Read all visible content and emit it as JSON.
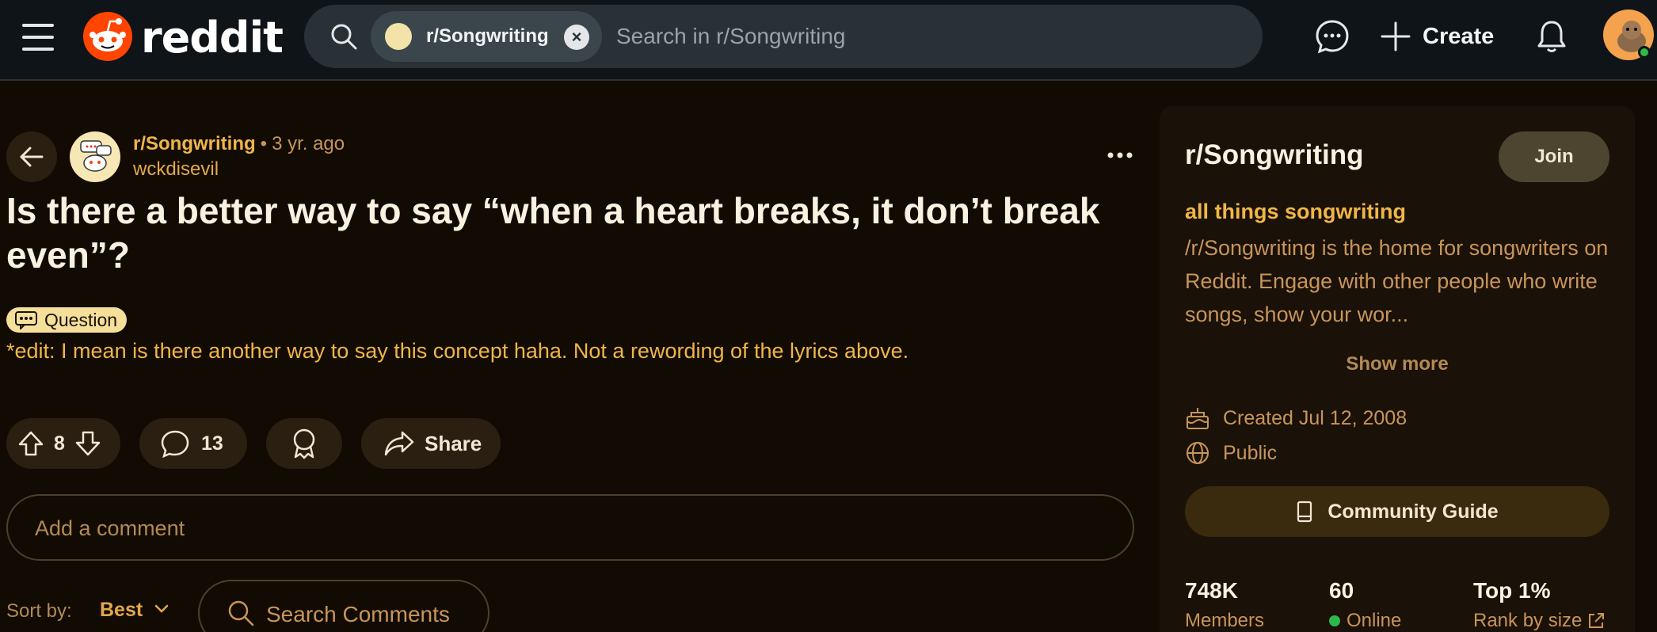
{
  "header": {
    "logo_text": "reddit",
    "search": {
      "scope_label": "r/Songwriting",
      "placeholder": "Search in r/Songwriting"
    },
    "create_label": "Create",
    "icons": [
      "menu-icon",
      "search-icon",
      "chat-icon",
      "plus-icon",
      "bell-icon"
    ]
  },
  "post": {
    "subreddit": "r/Songwriting",
    "separator": "•",
    "time": "3 yr. ago",
    "author": "wckdisevil",
    "title": "Is there a better way to say “when a heart breaks, it don’t break even”?",
    "flair": "Question",
    "body": "*edit: I mean is there another way to say this concept haha. Not a rewording of the lyrics above.",
    "votes": "8",
    "comments": "13",
    "share_label": "Share"
  },
  "comment_box": {
    "placeholder": "Add a comment"
  },
  "sort": {
    "label": "Sort by:",
    "value": "Best",
    "search_placeholder": "Search Comments"
  },
  "sidebar": {
    "title": "r/Songwriting",
    "join_label": "Join",
    "tagline": "all things songwriting",
    "description": "/r/Songwriting is the home for songwriters on Reddit. Engage with other people who write songs, show your wor...",
    "show_more": "Show more",
    "created": "Created Jul 12, 2008",
    "visibility": "Public",
    "guide_label": "Community Guide",
    "stats": [
      {
        "value": "748K",
        "label": "Members"
      },
      {
        "value": "60",
        "label": "Online"
      },
      {
        "value": "Top 1%",
        "label": "Rank by size"
      }
    ]
  },
  "colors": {
    "accent": "#f0b648",
    "brand": "#ff4500",
    "online": "#2fb84a"
  }
}
